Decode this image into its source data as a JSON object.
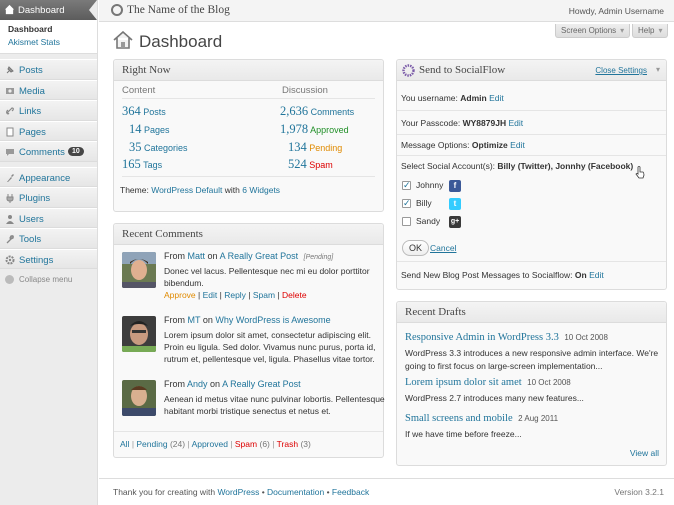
{
  "sidebar": {
    "dashboard": "Dashboard",
    "submenu": [
      "Dashboard",
      "Akismet Stats"
    ],
    "items": [
      {
        "label": "Posts"
      },
      {
        "label": "Media"
      },
      {
        "label": "Links"
      },
      {
        "label": "Pages"
      },
      {
        "label": "Comments",
        "badge": "10"
      },
      {
        "label": "Appearance"
      },
      {
        "label": "Plugins"
      },
      {
        "label": "Users"
      },
      {
        "label": "Tools"
      },
      {
        "label": "Settings"
      }
    ],
    "collapse": "Collapse menu"
  },
  "header": {
    "blog_name": "The Name of the Blog",
    "howdy": "Howdy, Admin Username",
    "screen_options": "Screen Options",
    "help": "Help"
  },
  "page_title": "Dashboard",
  "right_now": {
    "title": "Right Now",
    "content_label": "Content",
    "discussion_label": "Discussion",
    "content": [
      {
        "num": "364",
        "label": "Posts"
      },
      {
        "num": "14",
        "label": "Pages"
      },
      {
        "num": "35",
        "label": "Categories"
      },
      {
        "num": "165",
        "label": "Tags"
      }
    ],
    "discussion": [
      {
        "num": "2,636",
        "label": "Comments"
      },
      {
        "num": "1,978",
        "label": "Approved"
      },
      {
        "num": "134",
        "label": "Pending"
      },
      {
        "num": "524",
        "label": "Spam"
      }
    ],
    "theme_prefix": "Theme:",
    "theme_name": "WordPress Default",
    "theme_with": "with",
    "widgets": "6 Widgets"
  },
  "recent_comments": {
    "title": "Recent Comments",
    "items": [
      {
        "from": "From",
        "author": "Matt",
        "on": "on",
        "post": "A Really Great Post",
        "status": "[Pending]",
        "text1": "Donec vel lacus. Pellentesque nec mi eu dolor porttitor",
        "text2": "bibendum.",
        "actions": [
          "Approve",
          "Edit",
          "Reply",
          "Spam",
          "Delete"
        ]
      },
      {
        "from": "From",
        "author": "MT",
        "on": "on",
        "post": "Why WordPress is Awesome",
        "text1": "Lorem ipsum dolor sit amet, consectetur adipiscing elit.",
        "text2": "Proin eu ligula. Sed dolor. Vivamus nunc purus, porta id,",
        "text3": "rutrum et, pellentesque vel, ligula. Phasellus vitae tortor."
      },
      {
        "from": "From",
        "author": "Andy",
        "on": "on",
        "post": "A Really Great Post",
        "text1": "Aenean id metus vitae nunc pulvinar lobortis. Pellentesque",
        "text2": "habitant morbi tristique senectus et netus et."
      }
    ],
    "footer": {
      "all": "All",
      "pending": "Pending",
      "pending_count": "(24)",
      "approved": "Approved",
      "spam": "Spam",
      "spam_count": "(6)",
      "trash": "Trash",
      "trash_count": "(3)"
    }
  },
  "socialflow": {
    "title": "Send to SocialFlow",
    "close_settings": "Close Settings",
    "username_label": "You username:",
    "username": "Admin",
    "username_edit": "Edit",
    "passcode_label": "Your Passcode:",
    "passcode": "WY8879JH",
    "passcode_edit": "Edit",
    "message_label": "Message Options:",
    "message": "Optimize",
    "message_edit": "Edit",
    "select_label": "Select Social Account(s):",
    "select_value": "Billy (Twitter), Jonnhy (Facebook)",
    "accounts": [
      {
        "name": "Johnny",
        "checked": true,
        "icon": "facebook-icon"
      },
      {
        "name": "Billy",
        "checked": true,
        "icon": "twitter-icon"
      },
      {
        "name": "Sandy",
        "checked": false,
        "icon": "google-plus-icon"
      }
    ],
    "ok": "OK",
    "cancel": "Cancel",
    "send_label": "Send New Blog Post Messages to Socialflow:",
    "send_value": "On",
    "send_edit": "Edit"
  },
  "recent_drafts": {
    "title": "Recent Drafts",
    "items": [
      {
        "title": "Responsive Admin in WordPress 3.3",
        "date": "10 Oct 2008",
        "text1": "WordPress 3.3 introduces a new responsive admin interface. We're",
        "text2": "going to first focus on large-screen implementation..."
      },
      {
        "title": "Lorem ipsum dolor sit amet",
        "date": "10 Oct 2008",
        "text1": "WordPress 2.7 introduces many new features..."
      },
      {
        "title": "Small screens and mobile",
        "date": "2 Aug 2011",
        "text1": "If we have time before freeze..."
      }
    ],
    "view_all": "View all"
  },
  "footer": {
    "thanks": "Thank you for creating with",
    "wordpress": "WordPress",
    "documentation": "Documentation",
    "feedback": "Feedback",
    "version": "Version 3.2.1"
  }
}
